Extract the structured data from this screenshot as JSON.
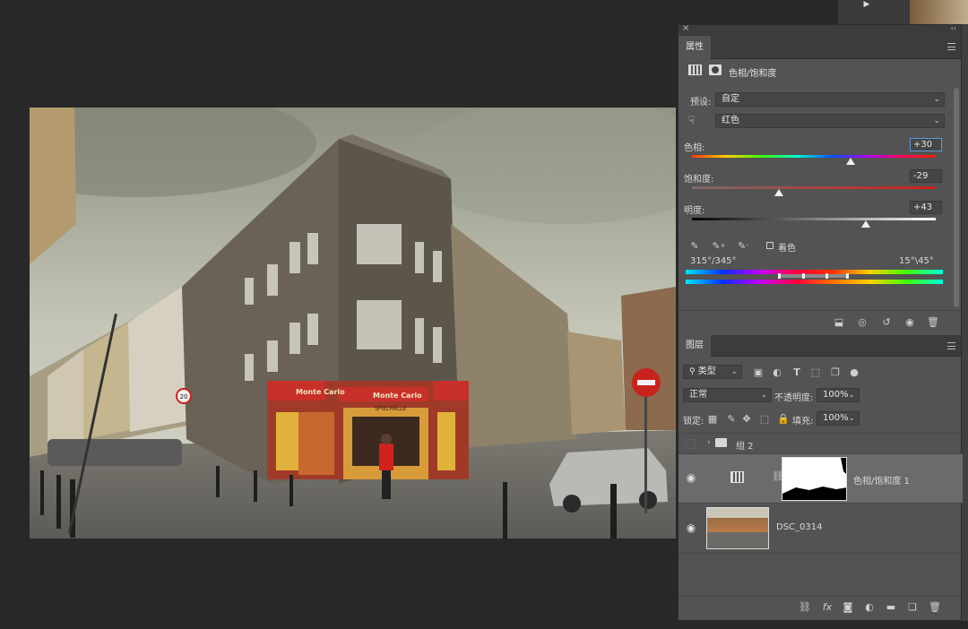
{
  "canvas": {
    "shop_sign": "Monte Carlo",
    "shop_sign_2": "Monte Carlo",
    "shop_sub": "SPIELHALLE",
    "speed_sign": "20"
  },
  "properties": {
    "close_glyph": "×",
    "collapse_glyph": "‹‹",
    "tab_label": "属性",
    "adjustment_title": "色相/饱和度",
    "preset_label": "预设:",
    "preset_value": "自定",
    "channel_value": "红色",
    "hue_label": "色相:",
    "hue_value": "+30",
    "hue_level": 0.65,
    "saturation_label": "饱和度:",
    "saturation_value": "-29",
    "saturation_level": 0.355,
    "lightness_label": "明度:",
    "lightness_value": "+43",
    "lightness_level": 0.715,
    "colorize_label": "着色",
    "range_left": "315°/345°",
    "range_right": "15°\\45°"
  },
  "layers": {
    "tab_label": "图层",
    "filter_kind": "类型",
    "blend_mode": "正常",
    "opacity_label": "不透明度:",
    "opacity_value": "100%",
    "lock_label": "锁定:",
    "fill_label": "填充:",
    "fill_value": "100%",
    "items": [
      {
        "name": "组 2"
      },
      {
        "name": "色相/饱和度 1"
      },
      {
        "name": "DSC_0314"
      }
    ]
  },
  "colors": {
    "panel_bg": "#535353",
    "panel_dark": "#3c3c3c",
    "selected_row": "#6b6b6b",
    "accent": "#5a9bd8"
  }
}
